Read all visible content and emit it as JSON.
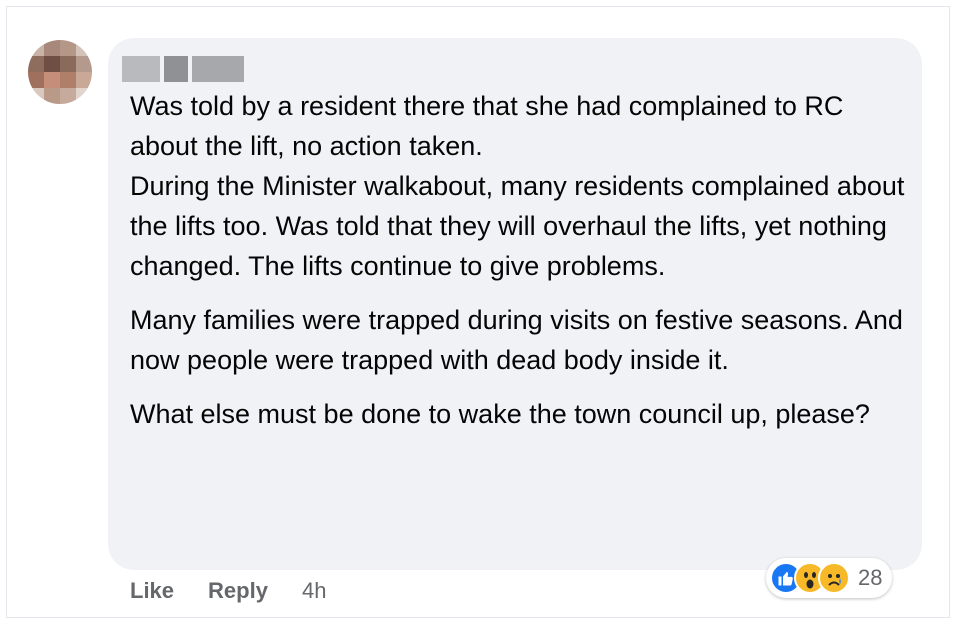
{
  "comment": {
    "paragraphs": [
      "Was told by a resident there that she had complained to RC about the lift, no action taken.",
      "During the Minister walkabout, many residents complained about the lifts too. Was told that they will overhaul the lifts, yet nothing changed. The lifts continue to give problems.",
      "Many families were trapped during visits on festive seasons. And now people were trapped with dead body inside it.",
      "What else must be done to wake the town council up, please?"
    ]
  },
  "actions": {
    "like_label": "Like",
    "reply_label": "Reply",
    "timestamp": "4h"
  },
  "reactions": {
    "icons": [
      "like-icon",
      "wow-icon",
      "sad-icon"
    ],
    "count": "28"
  },
  "colors": {
    "bubble": "#f0f2f5",
    "text": "#050505",
    "muted": "#65676b",
    "like_blue": "#1877f2",
    "emoji_yellow": "#f7b928"
  }
}
